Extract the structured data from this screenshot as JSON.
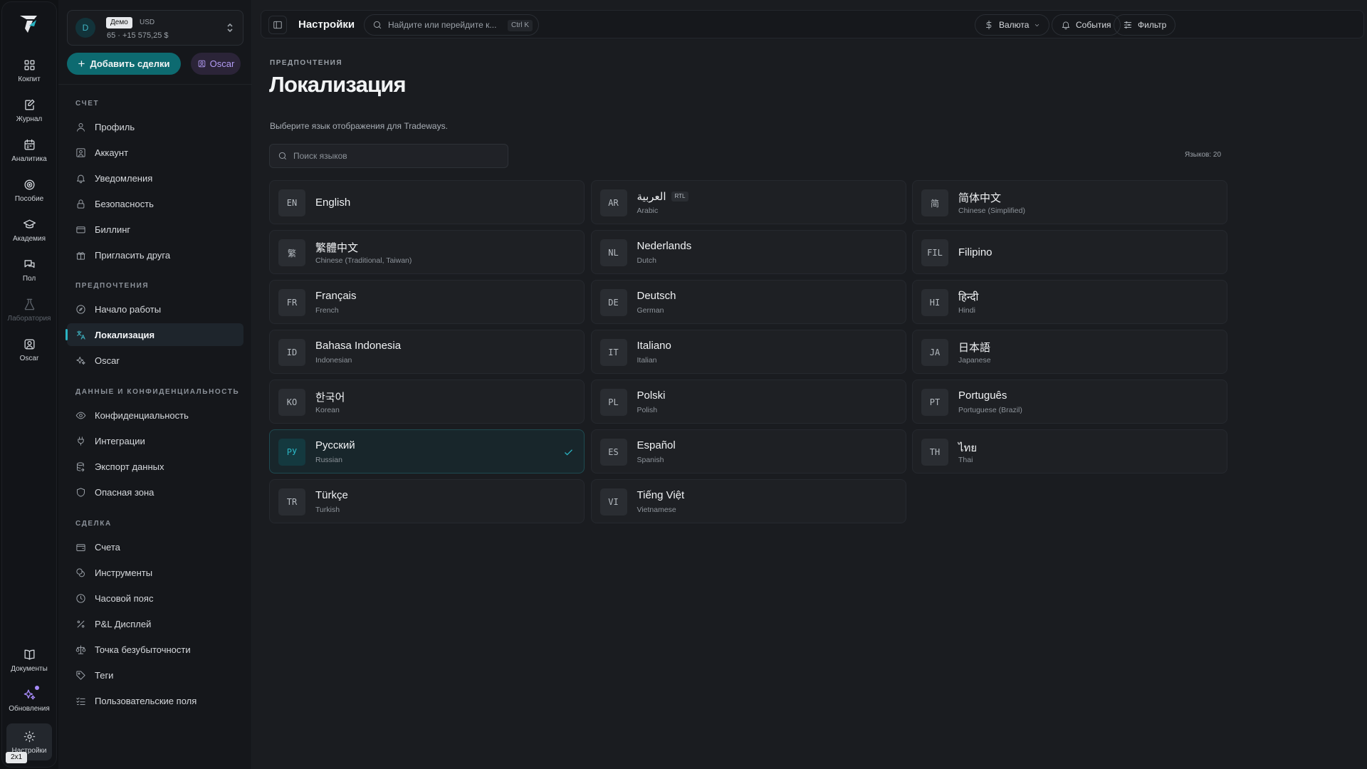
{
  "rail": {
    "items": [
      {
        "label": "Кокпит",
        "icon": "dashboard-icon"
      },
      {
        "label": "Журнал",
        "icon": "journal-icon"
      },
      {
        "label": "Аналитика",
        "icon": "analytics-icon"
      },
      {
        "label": "Пособие",
        "icon": "playbook-icon"
      },
      {
        "label": "Академия",
        "icon": "academy-icon"
      },
      {
        "label": "Пол",
        "icon": "chat-icon"
      },
      {
        "label": "Лаборатория",
        "icon": "lab-icon"
      },
      {
        "label": "Oscar",
        "icon": "oscar-icon"
      }
    ],
    "bottom": [
      {
        "label": "Документы",
        "icon": "book-icon"
      },
      {
        "label": "Обновления",
        "icon": "sparkle-icon"
      },
      {
        "label": "Настройки",
        "icon": "gear-icon"
      }
    ],
    "badge": "2x1"
  },
  "account": {
    "avatar": "D",
    "mode": "Демо",
    "currency": "USD",
    "balance": "65 · +15 575,25 $"
  },
  "actions": {
    "add_trades": "Добавить сделки",
    "oscar": "Oscar"
  },
  "sidebar": {
    "sections": [
      {
        "title": "СЧЕТ",
        "items": [
          "Профиль",
          "Аккаунт",
          "Уведомления",
          "Безопасность",
          "Биллинг",
          "Пригласить друга"
        ]
      },
      {
        "title": "ПРЕДПОЧТЕНИЯ",
        "items": [
          "Начало работы",
          "Локализация",
          "Oscar"
        ]
      },
      {
        "title": "ДАННЫЕ И КОНФИДЕНЦИАЛЬНОСТЬ",
        "items": [
          "Конфиденциальность",
          "Интеграции",
          "Экспорт данных",
          "Опасная зона"
        ]
      },
      {
        "title": "СДЕЛКА",
        "items": [
          "Счета",
          "Инструменты",
          "Часовой пояс",
          "P&L Дисплей",
          "Точка безубыточности",
          "Теги",
          "Пользовательские поля"
        ]
      }
    ]
  },
  "topbar": {
    "title": "Настройки",
    "search_placeholder": "Найдите или перейдите к...",
    "shortcut": "Ctrl K",
    "currency_btn": "Валюта",
    "events_btn": "События",
    "filter_btn": "Фильтр"
  },
  "page": {
    "eyebrow": "ПРЕДПОЧТЕНИЯ",
    "title": "Локализация",
    "description": "Выберите язык отображения для Tradeways.",
    "search_placeholder": "Поиск языков",
    "count": "Языков: 20"
  },
  "languages": [
    {
      "code": "EN",
      "native": "English",
      "english": ""
    },
    {
      "code": "AR",
      "native": "العربية",
      "english": "Arabic",
      "tag": "RTL"
    },
    {
      "code": "简",
      "native": "简体中文",
      "english": "Chinese (Simplified)"
    },
    {
      "code": "繁",
      "native": "繁體中文",
      "english": "Chinese (Traditional, Taiwan)"
    },
    {
      "code": "NL",
      "native": "Nederlands",
      "english": "Dutch"
    },
    {
      "code": "FIL",
      "native": "Filipino",
      "english": ""
    },
    {
      "code": "FR",
      "native": "Français",
      "english": "French"
    },
    {
      "code": "DE",
      "native": "Deutsch",
      "english": "German"
    },
    {
      "code": "HI",
      "native": "हिन्दी",
      "english": "Hindi"
    },
    {
      "code": "ID",
      "native": "Bahasa Indonesia",
      "english": "Indonesian"
    },
    {
      "code": "IT",
      "native": "Italiano",
      "english": "Italian"
    },
    {
      "code": "JA",
      "native": "日本語",
      "english": "Japanese"
    },
    {
      "code": "KO",
      "native": "한국어",
      "english": "Korean"
    },
    {
      "code": "PL",
      "native": "Polski",
      "english": "Polish"
    },
    {
      "code": "PT",
      "native": "Português",
      "english": "Portuguese (Brazil)"
    },
    {
      "code": "РУ",
      "native": "Русский",
      "english": "Russian",
      "selected": true
    },
    {
      "code": "ES",
      "native": "Español",
      "english": "Spanish"
    },
    {
      "code": "TH",
      "native": "ไทย",
      "english": "Thai"
    },
    {
      "code": "TR",
      "native": "Türkçe",
      "english": "Turkish"
    },
    {
      "code": "VI",
      "native": "Tiếng Việt",
      "english": "Vietnamese"
    }
  ],
  "colors": {
    "accent": "#2ab3c2",
    "primary_button": "#0d6a70",
    "oscar": "#b39cf5",
    "background": "#1a1c20"
  }
}
